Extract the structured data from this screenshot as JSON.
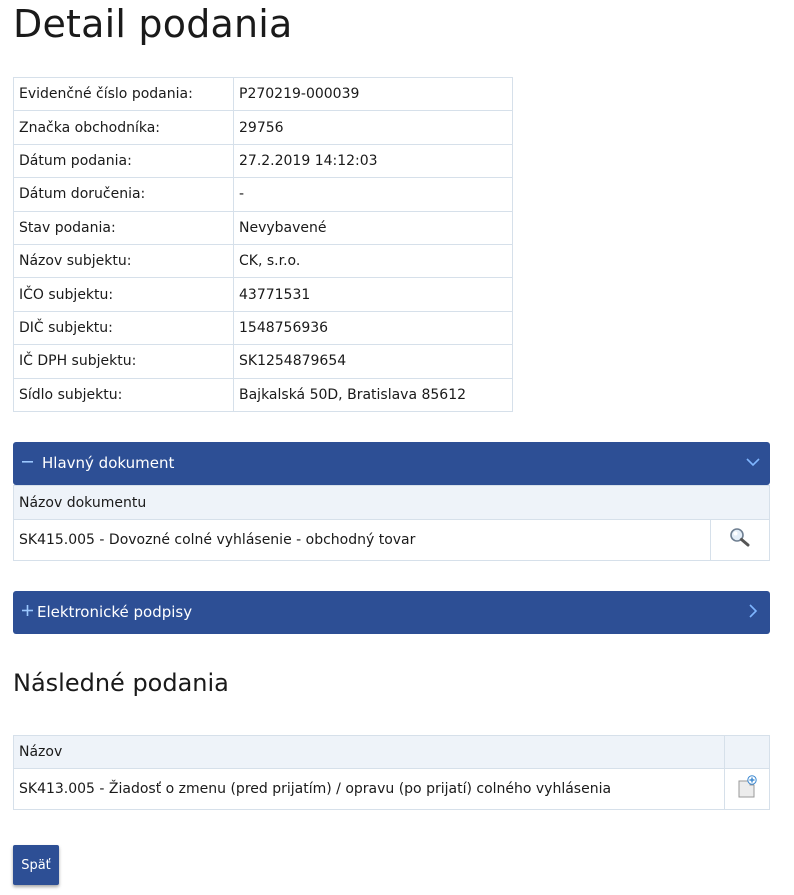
{
  "page": {
    "title": "Detail podania"
  },
  "details": [
    {
      "label": "Evidenčné číslo podania:",
      "value": "P270219-000039"
    },
    {
      "label": "Značka obchodníka:",
      "value": "29756"
    },
    {
      "label": "Dátum podania:",
      "value": "27.2.2019 14:12:03"
    },
    {
      "label": "Dátum doručenia:",
      "value": "-"
    },
    {
      "label": "Stav podania:",
      "value": "Nevybavené"
    },
    {
      "label": "Názov subjektu:",
      "value": "CK, s.r.o."
    },
    {
      "label": "IČO subjektu:",
      "value": "43771531"
    },
    {
      "label": "DIČ subjektu:",
      "value": "1548756936"
    },
    {
      "label": "IČ DPH subjektu:",
      "value": "SK1254879654"
    },
    {
      "label": "Sídlo subjektu:",
      "value": "Bajkalská 50D, Bratislava 85612"
    }
  ],
  "main_document": {
    "header_label": "Hlavný dokument",
    "expanded_icon": "minus-icon",
    "column": "Názov dokumentu",
    "rows": [
      {
        "name": "SK415.005 - Dovozné colné vyhlásenie - obchodný tovar",
        "action_icon": "magnifier-icon"
      }
    ]
  },
  "signatures": {
    "header_label": "Elektronické podpisy",
    "collapsed_icon": "plus-icon"
  },
  "followups": {
    "title": "Následné podania",
    "column": "Názov",
    "rows": [
      {
        "name": "SK413.005 - Žiadosť o zmenu (pred prijatím) / opravu (po prijatí) colného vyhlásenia",
        "action_icon": "new-document-icon"
      }
    ]
  },
  "back_button": {
    "label": "Späť"
  },
  "colors": {
    "header_blue": "#2d4f95",
    "border": "#d6e0ea",
    "header_row_bg": "#eef3f9"
  }
}
